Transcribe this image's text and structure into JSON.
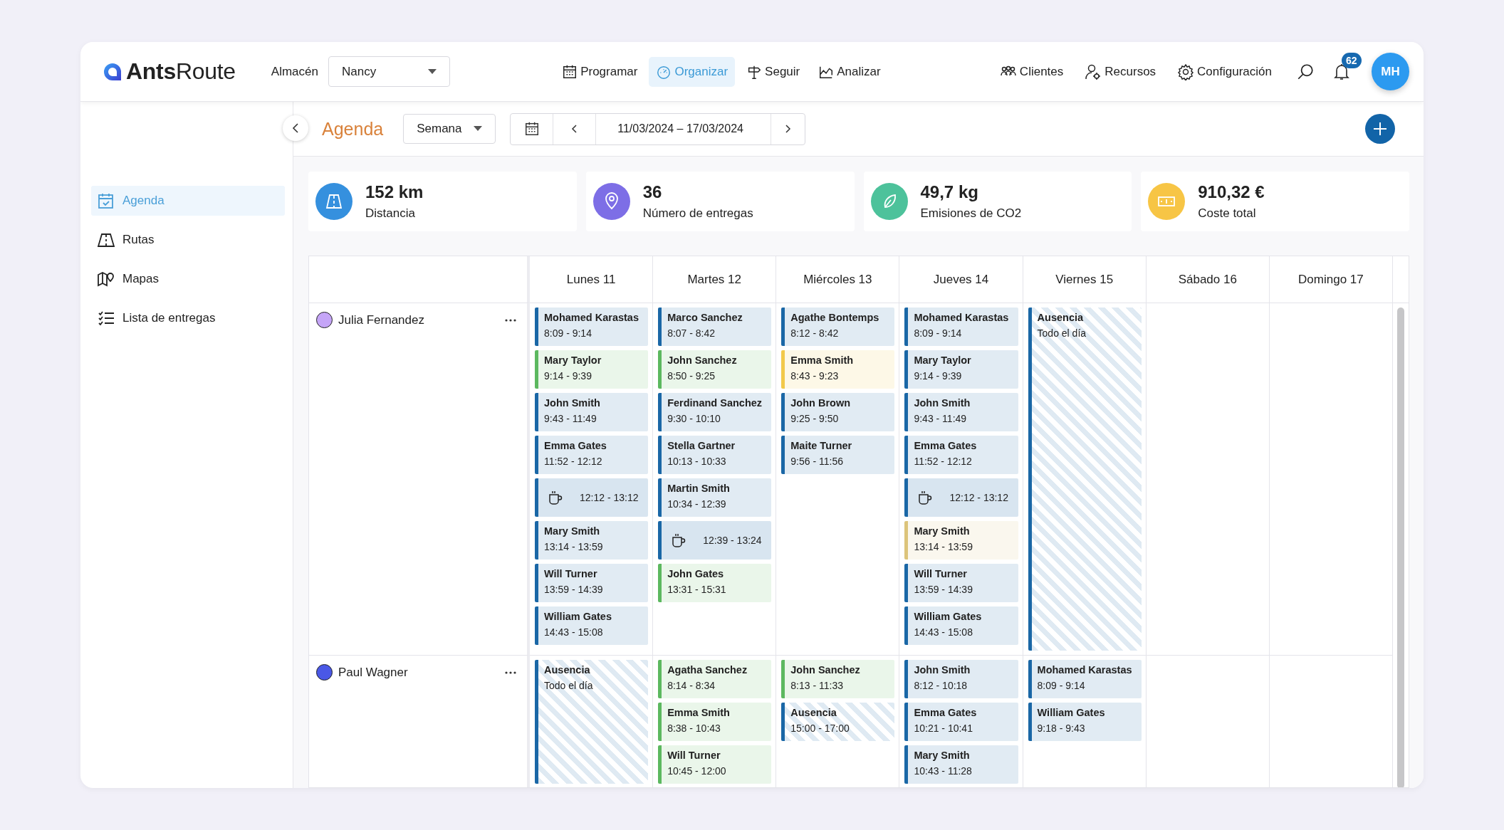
{
  "header": {
    "logo": "**Ants**Route",
    "warehouse_label": "Almacén",
    "warehouse": "Nancy",
    "nav": [
      {
        "label": "Programar",
        "selected": false
      },
      {
        "label": "Organizar",
        "selected": true
      },
      {
        "label": "Seguir",
        "selected": false
      },
      {
        "label": "Analizar",
        "selected": false
      }
    ],
    "tools": [
      "Clientes",
      "Recursos",
      "Configuración"
    ],
    "notifications": "62",
    "avatar": "MH"
  },
  "sidebar": {
    "items": [
      {
        "label": "Agenda",
        "selected": true
      },
      {
        "label": "Rutas",
        "selected": false
      },
      {
        "label": "Mapas",
        "selected": false
      },
      {
        "label": "Lista de entregas",
        "selected": false
      }
    ]
  },
  "toolbar": {
    "title": "Agenda",
    "view": "Semana",
    "date_range": "11/03/2024 – 17/03/2024"
  },
  "stats": [
    {
      "value": "152 km",
      "label": "Distancia",
      "color": "#3590de"
    },
    {
      "value": "36",
      "label": "Número de entregas",
      "color": "#7d6ee6"
    },
    {
      "value": "49,7 kg",
      "label": "Emisiones de CO2",
      "color": "#4dc29b"
    },
    {
      "value": "910,32 €",
      "label": "Coste total",
      "color": "#f7c545"
    }
  ],
  "calendar": {
    "days": [
      "Lunes 11",
      "Martes 12",
      "Miércoles 13",
      "Jueves 14",
      "Viernes 15",
      "Sábado 16",
      "Domingo 17"
    ],
    "resources": [
      {
        "name": "Julia Fernandez",
        "color": "#c5a5f7",
        "days": [
          [
            {
              "kind": "visit",
              "name": "Mohamed Karastas",
              "time": "8:09 - 9:14",
              "color": "#1a67a6"
            },
            {
              "kind": "visit",
              "name": "Mary Taylor",
              "time": "9:14 - 9:39",
              "color": "#5cb85f"
            },
            {
              "kind": "visit",
              "name": "John Smith",
              "time": "9:43 - 11:49",
              "color": "#1a67a6"
            },
            {
              "kind": "visit",
              "name": "Emma Gates",
              "time": "11:52 - 12:12",
              "color": "#1a67a6"
            },
            {
              "kind": "break",
              "time": "12:12 - 13:12",
              "color": "#1a67a6"
            },
            {
              "kind": "visit",
              "name": "Mary Smith",
              "time": "13:14 - 13:59",
              "color": "#1a67a6"
            },
            {
              "kind": "visit",
              "name": "Will Turner",
              "time": "13:59 - 14:39",
              "color": "#1a67a6"
            },
            {
              "kind": "visit",
              "name": "William Gates",
              "time": "14:43 - 15:08",
              "color": "#1a67a6"
            }
          ],
          [
            {
              "kind": "visit",
              "name": "Marco Sanchez",
              "time": "8:07 - 8:42",
              "color": "#1a67a6"
            },
            {
              "kind": "visit",
              "name": "John Sanchez",
              "time": "8:50 - 9:25",
              "color": "#5cb85f"
            },
            {
              "kind": "visit",
              "name": "Ferdinand Sanchez",
              "time": "9:30 - 10:10",
              "color": "#1a67a6"
            },
            {
              "kind": "visit",
              "name": "Stella Gartner",
              "time": "10:13 - 10:33",
              "color": "#1a67a6"
            },
            {
              "kind": "visit",
              "name": "Martin Smith",
              "time": "10:34 - 12:39",
              "color": "#1a67a6"
            },
            {
              "kind": "break",
              "time": "12:39 - 13:24",
              "color": "#1a67a6"
            },
            {
              "kind": "visit",
              "name": "John Gates",
              "time": "13:31 - 15:31",
              "color": "#5cb85f"
            }
          ],
          [
            {
              "kind": "visit",
              "name": "Agathe Bontemps",
              "time": "8:12 - 8:42",
              "color": "#1a67a6"
            },
            {
              "kind": "visit",
              "name": "Emma Smith",
              "time": "8:43 - 9:23",
              "color": "#f2c94a"
            },
            {
              "kind": "visit",
              "name": "John Brown",
              "time": "9:25 - 9:50",
              "color": "#1a67a6"
            },
            {
              "kind": "visit",
              "name": "Maite Turner",
              "time": "9:56 - 11:56",
              "color": "#1a67a6"
            }
          ],
          [
            {
              "kind": "visit",
              "name": "Mohamed Karastas",
              "time": "8:09 - 9:14",
              "color": "#1a67a6"
            },
            {
              "kind": "visit",
              "name": "Mary Taylor",
              "time": "9:14 - 9:39",
              "color": "#1a67a6"
            },
            {
              "kind": "visit",
              "name": "John Smith",
              "time": "9:43 - 11:49",
              "color": "#1a67a6"
            },
            {
              "kind": "visit",
              "name": "Emma Gates",
              "time": "11:52 - 12:12",
              "color": "#1a67a6"
            },
            {
              "kind": "break",
              "time": "12:12 - 13:12",
              "color": "#1a67a6"
            },
            {
              "kind": "visit",
              "name": "Mary Smith",
              "time": "13:14 - 13:59",
              "color": "#dcc47a"
            },
            {
              "kind": "visit",
              "name": "Will Turner",
              "time": "13:59 - 14:39",
              "color": "#1a67a6"
            },
            {
              "kind": "visit",
              "name": "William Gates",
              "time": "14:43 - 15:08",
              "color": "#1a67a6"
            }
          ],
          [
            {
              "kind": "absence",
              "name": "Ausencia",
              "time": "Todo el día",
              "all_day": true,
              "color": "#1a67a6"
            }
          ]
        ]
      },
      {
        "name": "Paul Wagner",
        "color": "#4a58e6",
        "days": [
          [
            {
              "kind": "absence",
              "name": "Ausencia",
              "time": "Todo el día",
              "all_day": true,
              "color": "#1a67a6"
            }
          ],
          [
            {
              "kind": "visit",
              "name": "Agatha Sanchez",
              "time": "8:14 - 8:34",
              "color": "#5cb85f"
            },
            {
              "kind": "visit",
              "name": "Emma Smith",
              "time": "8:38 - 10:43",
              "color": "#5cb85f"
            },
            {
              "kind": "visit",
              "name": "Will Turner",
              "time": "10:45 - 12:00",
              "color": "#5cb85f"
            }
          ],
          [
            {
              "kind": "visit",
              "name": "John Sanchez",
              "time": "8:13 - 11:33",
              "color": "#5cb85f"
            },
            {
              "kind": "absence",
              "name": "Ausencia",
              "time": "15:00 - 17:00",
              "all_day": false,
              "color": "#1a67a6"
            }
          ],
          [
            {
              "kind": "visit",
              "name": "John Smith",
              "time": "8:12 - 10:18",
              "color": "#1a67a6"
            },
            {
              "kind": "visit",
              "name": "Emma Gates",
              "time": "10:21 - 10:41",
              "color": "#1a67a6"
            },
            {
              "kind": "visit",
              "name": "Mary Smith",
              "time": "10:43 - 11:28",
              "color": "#1a67a6"
            }
          ],
          [
            {
              "kind": "visit",
              "name": "Mohamed Karastas",
              "time": "8:09 - 9:14",
              "color": "#1a67a6"
            },
            {
              "kind": "visit",
              "name": "William Gates",
              "time": "9:18 - 9:43",
              "color": "#1a67a6"
            }
          ]
        ]
      }
    ]
  }
}
